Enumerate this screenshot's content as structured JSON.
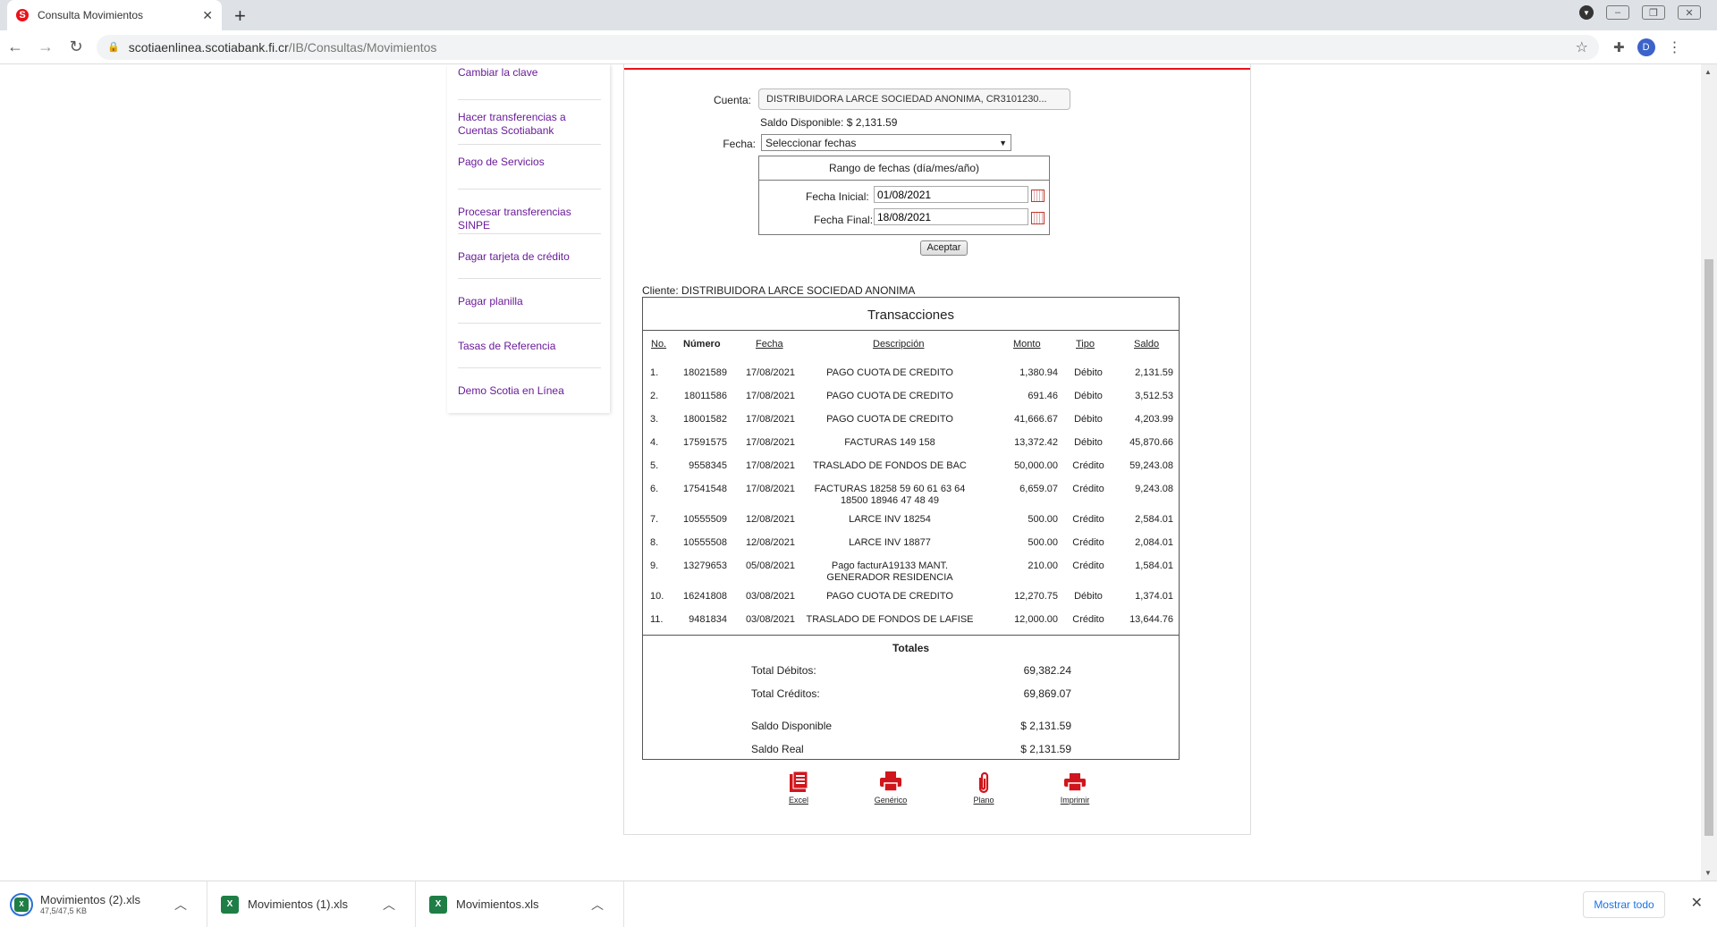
{
  "browser": {
    "tab_title": "Consulta Movimientos",
    "tab_close": "✕",
    "new_tab": "+",
    "url_host": "scotiaenlinea.scotiabank.fi.cr",
    "url_path": "/IB/Consultas/Movimientos",
    "profile_initial": "D"
  },
  "sidebar": {
    "items": [
      {
        "label": "Cambiar la clave"
      },
      {
        "label": "Hacer transferencias a Cuentas Scotiabank"
      },
      {
        "label": "Pago de Servicios"
      },
      {
        "label": "Procesar transferencias SINPE"
      },
      {
        "label": "Pagar tarjeta de crédito"
      },
      {
        "label": "Pagar planilla"
      },
      {
        "label": "Tasas de Referencia"
      },
      {
        "label": "Demo Scotia en Línea"
      }
    ]
  },
  "form": {
    "account_label": "Cuenta:",
    "account_value": "DISTRIBUIDORA LARCE SOCIEDAD ANONIMA, CR3101230...",
    "balance_text": "Saldo Disponible: $ 2,131.59",
    "date_label": "Fecha:",
    "date_select": "Seleccionar fechas",
    "range_title": "Rango de fechas (día/mes/año)",
    "start_label": "Fecha Inicial:",
    "start_value": "01/08/2021",
    "end_label": "Fecha Final:",
    "end_value": "18/08/2021",
    "accept_label": "Aceptar"
  },
  "client_line": "Cliente: DISTRIBUIDORA LARCE SOCIEDAD ANONIMA",
  "transactions": {
    "title": "Transacciones",
    "columns": [
      "No.",
      "Número",
      "Fecha",
      "Descripción",
      "Monto",
      "Tipo",
      "Saldo"
    ],
    "rows": [
      {
        "no": "1.",
        "num": "18021589",
        "date": "17/08/2021",
        "desc": "PAGO CUOTA DE CREDITO",
        "amount": "1,380.94",
        "type": "Débito",
        "balance": "2,131.59"
      },
      {
        "no": "2.",
        "num": "18011586",
        "date": "17/08/2021",
        "desc": "PAGO CUOTA DE CREDITO",
        "amount": "691.46",
        "type": "Débito",
        "balance": "3,512.53"
      },
      {
        "no": "3.",
        "num": "18001582",
        "date": "17/08/2021",
        "desc": "PAGO CUOTA DE CREDITO",
        "amount": "41,666.67",
        "type": "Débito",
        "balance": "4,203.99"
      },
      {
        "no": "4.",
        "num": "17591575",
        "date": "17/08/2021",
        "desc": "FACTURAS 149 158",
        "amount": "13,372.42",
        "type": "Débito",
        "balance": "45,870.66"
      },
      {
        "no": "5.",
        "num": "9558345",
        "date": "17/08/2021",
        "desc": "TRASLADO DE FONDOS DE BAC",
        "amount": "50,000.00",
        "type": "Crédito",
        "balance": "59,243.08"
      },
      {
        "no": "6.",
        "num": "17541548",
        "date": "17/08/2021",
        "desc": "FACTURAS 18258 59 60 61 63 64 18500 18946 47 48 49",
        "amount": "6,659.07",
        "type": "Crédito",
        "balance": "9,243.08"
      },
      {
        "no": "7.",
        "num": "10555509",
        "date": "12/08/2021",
        "desc": "LARCE INV 18254",
        "amount": "500.00",
        "type": "Crédito",
        "balance": "2,584.01"
      },
      {
        "no": "8.",
        "num": "10555508",
        "date": "12/08/2021",
        "desc": "LARCE INV 18877",
        "amount": "500.00",
        "type": "Crédito",
        "balance": "2,084.01"
      },
      {
        "no": "9.",
        "num": "13279653",
        "date": "05/08/2021",
        "desc": "Pago facturA19133 MANT. GENERADOR RESIDENCIA",
        "amount": "210.00",
        "type": "Crédito",
        "balance": "1,584.01"
      },
      {
        "no": "10.",
        "num": "16241808",
        "date": "03/08/2021",
        "desc": "PAGO CUOTA DE CREDITO",
        "amount": "12,270.75",
        "type": "Débito",
        "balance": "1,374.01"
      },
      {
        "no": "11.",
        "num": "9481834",
        "date": "03/08/2021",
        "desc": "TRASLADO DE FONDOS DE LAFISE",
        "amount": "12,000.00",
        "type": "Crédito",
        "balance": "13,644.76"
      }
    ],
    "totals_title": "Totales",
    "totals": [
      {
        "label": "Total Débitos:",
        "value": "69,382.24"
      },
      {
        "label": "Total Créditos:",
        "value": "69,869.07"
      },
      {
        "label": "Saldo Disponible",
        "value": "$ 2,131.59"
      },
      {
        "label": "Saldo Real",
        "value": "$ 2,131.59"
      }
    ]
  },
  "exports": [
    {
      "label": "Excel",
      "icon": "excel-icon"
    },
    {
      "label": "Genérico",
      "icon": "printer-icon"
    },
    {
      "label": "Plano",
      "icon": "paperclip-icon"
    },
    {
      "label": "Imprimir",
      "icon": "printer-icon"
    }
  ],
  "downloads": {
    "items": [
      {
        "name": "Movimientos (2).xls",
        "size": "47,5/47,5 KB"
      },
      {
        "name": "Movimientos (1).xls",
        "size": ""
      },
      {
        "name": "Movimientos.xls",
        "size": ""
      }
    ],
    "show_all": "Mostrar todo"
  },
  "colors": {
    "brand_red": "#ec111a",
    "link_purple": "#6a1b9a",
    "show_all_blue": "#1a73e8"
  }
}
